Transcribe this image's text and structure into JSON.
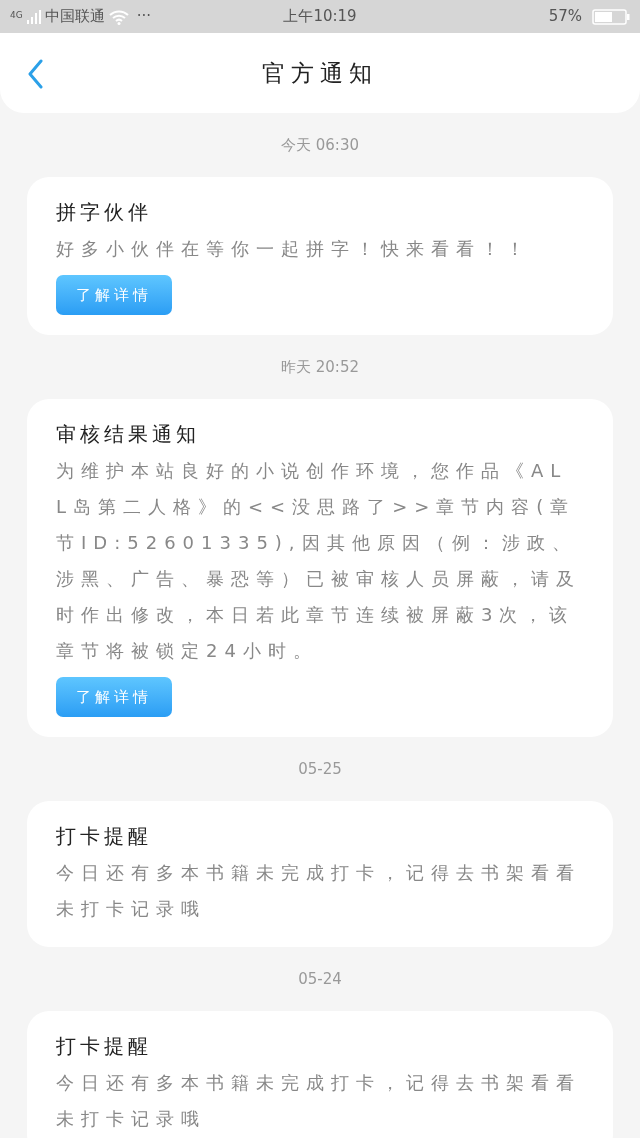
{
  "status_bar": {
    "network": "4G",
    "carrier": "中国联通",
    "more": "···",
    "time": "上午10:19",
    "battery": "57%"
  },
  "header": {
    "title": "官方通知"
  },
  "groups": [
    {
      "timestamp": "今天 06:30",
      "title": "拼字伙伴",
      "body": "好多小伙伴在等你一起拼字！快来看看！！",
      "button": "了解详情"
    },
    {
      "timestamp": "昨天 20:52",
      "title": "审核结果通知",
      "body": "为维护本站良好的小说创作环境，您作品《ALL岛第二人格》的<<没思路了>>章节内容(章节ID:52601335),因其他原因（例：涉政、涉黑、广告、暴恐等）已被审核人员屏蔽，请及时作出修改，本日若此章节连续被屏蔽3次，该章节将被锁定24小时。",
      "button": "了解详情"
    },
    {
      "timestamp": "05-25",
      "title": "打卡提醒",
      "body": "今日还有多本书籍未完成打卡，记得去书架看看未打卡记录哦"
    },
    {
      "timestamp": "05-24",
      "title": "打卡提醒",
      "body": "今日还有多本书籍未完成打卡，记得去书架看看未打卡记录哦"
    }
  ]
}
